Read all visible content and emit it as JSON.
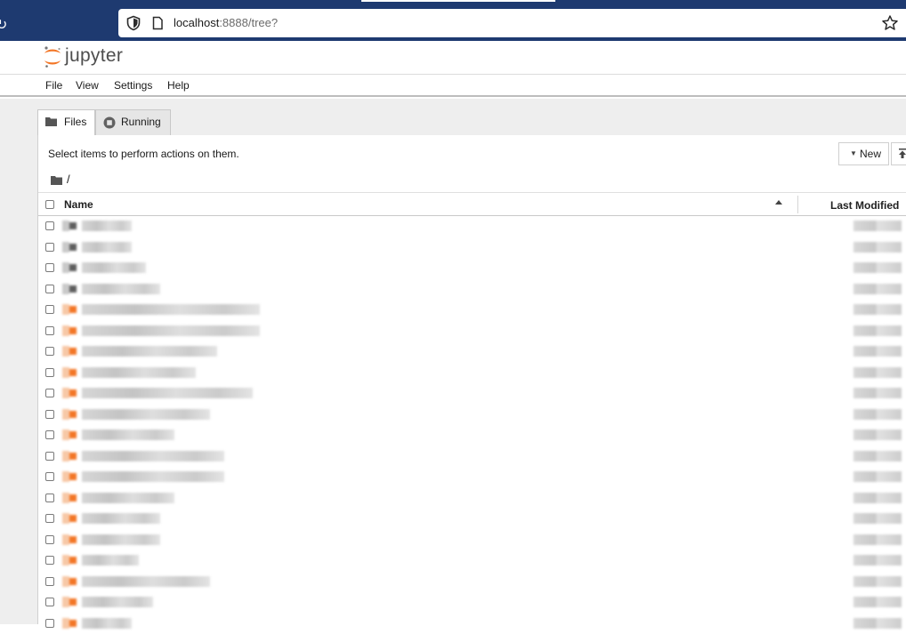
{
  "browser": {
    "url_host": "localhost",
    "url_rest": ":8888/tree?"
  },
  "header": {
    "brand": "jupyter"
  },
  "menu": [
    "File",
    "View",
    "Settings",
    "Help"
  ],
  "tabs": [
    {
      "label": "Files",
      "icon": "folder-icon"
    },
    {
      "label": "Running",
      "icon": "stop-circle-icon"
    }
  ],
  "toolbar": {
    "hint": "Select items to perform actions on them.",
    "new_label": "New"
  },
  "breadcrumb": {
    "separator": "/"
  },
  "table": {
    "col_name": "Name",
    "col_modified": "Last Modified"
  },
  "files": [
    {
      "kind": "folder",
      "name": "",
      "modified": ""
    },
    {
      "kind": "folder",
      "name": "",
      "modified": ""
    },
    {
      "kind": "folder",
      "name": "",
      "modified": ""
    },
    {
      "kind": "folder",
      "name": "",
      "modified": ""
    },
    {
      "kind": "notebook",
      "name": "",
      "modified": ""
    },
    {
      "kind": "notebook",
      "name": "",
      "modified": ""
    },
    {
      "kind": "notebook",
      "name": "",
      "modified": ""
    },
    {
      "kind": "notebook",
      "name": "",
      "modified": ""
    },
    {
      "kind": "notebook",
      "name": "",
      "modified": ""
    },
    {
      "kind": "notebook",
      "name": "",
      "modified": ""
    },
    {
      "kind": "notebook",
      "name": "",
      "modified": ""
    },
    {
      "kind": "notebook",
      "name": "",
      "modified": ""
    },
    {
      "kind": "notebook",
      "name": "",
      "modified": ""
    },
    {
      "kind": "notebook",
      "name": "",
      "modified": ""
    },
    {
      "kind": "notebook",
      "name": "",
      "modified": ""
    },
    {
      "kind": "notebook",
      "name": "",
      "modified": ""
    },
    {
      "kind": "notebook",
      "name": "",
      "modified": ""
    },
    {
      "kind": "notebook",
      "name": "",
      "modified": ""
    },
    {
      "kind": "notebook",
      "name": "",
      "modified": ""
    },
    {
      "kind": "notebook",
      "name": "",
      "modified": ""
    }
  ],
  "colors": {
    "browser_bar": "#1e3a70",
    "jupyter_orange": "#f37626",
    "folder_gray": "#5a5a5a",
    "background": "#eeeeee"
  }
}
